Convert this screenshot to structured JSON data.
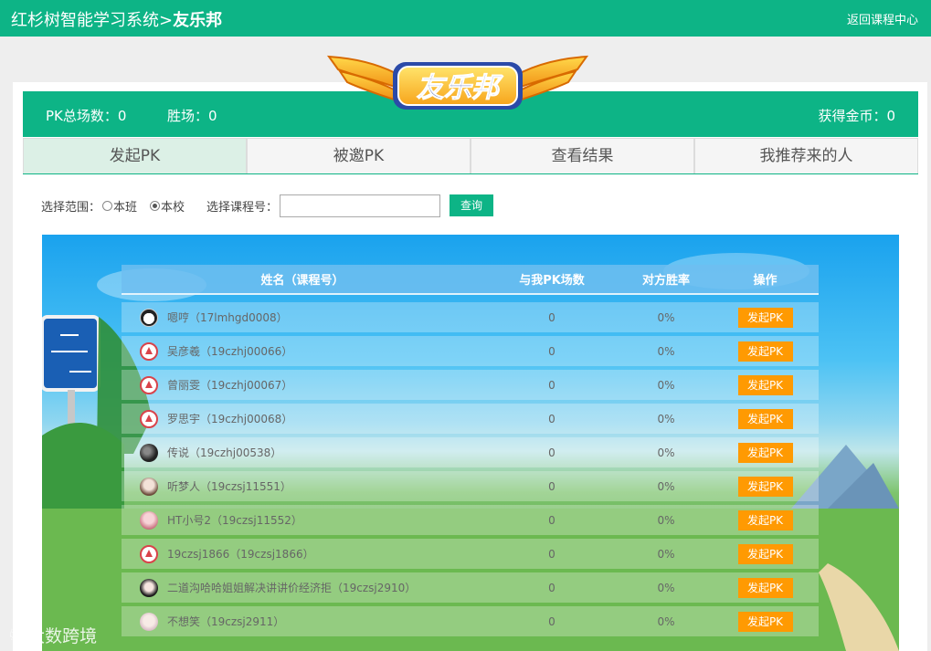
{
  "header": {
    "system_name": "红杉树智能学习系统",
    "separator": ">",
    "module_name": "友乐邦",
    "back_link": "返回课程中心"
  },
  "logo": {
    "text": "友乐邦"
  },
  "stats": {
    "total_pk": "PK总场数：0",
    "wins": "胜场：0",
    "coins": "获得金币：0"
  },
  "tabs": [
    {
      "label": "发起PK",
      "active": true
    },
    {
      "label": "被邀PK",
      "active": false
    },
    {
      "label": "查看结果",
      "active": false
    },
    {
      "label": "我推荐来的人",
      "active": false
    }
  ],
  "filter": {
    "scope_label": "选择范围：",
    "option_class": "本班",
    "option_school": "本校",
    "selected": "本校",
    "course_label": "选择课程号：",
    "course_value": "",
    "query_button": "查询"
  },
  "table": {
    "headers": {
      "name": "姓名（课程号）",
      "count": "与我PK场数",
      "rate": "对方胜率",
      "op": "操作"
    },
    "action_label": "发起PK",
    "rows": [
      {
        "name": "嗯哼（17lmhgd0008）",
        "count": "0",
        "rate": "0%",
        "avatar": "panda"
      },
      {
        "name": "吴彦羲（19czhj00066）",
        "count": "0",
        "rate": "0%",
        "avatar": "logo"
      },
      {
        "name": "曾丽雯（19czhj00067）",
        "count": "0",
        "rate": "0%",
        "avatar": "logo"
      },
      {
        "name": "罗思宇（19czhj00068）",
        "count": "0",
        "rate": "0%",
        "avatar": "logo"
      },
      {
        "name": "传说（19czhj00538）",
        "count": "0",
        "rate": "0%",
        "avatar": "dark"
      },
      {
        "name": "听梦人（19czsj11551）",
        "count": "0",
        "rate": "0%",
        "avatar": "girl"
      },
      {
        "name": "HT小号2（19czsj11552）",
        "count": "0",
        "rate": "0%",
        "avatar": "pink"
      },
      {
        "name": "19czsj1866（19czsj1866）",
        "count": "0",
        "rate": "0%",
        "avatar": "logo"
      },
      {
        "name": "二道沟哈哈姐姐解决讲讲价经济拒（19czsj2910）",
        "count": "0",
        "rate": "0%",
        "avatar": "anime"
      },
      {
        "name": "不想笑（19czsj2911）",
        "count": "0",
        "rate": "0%",
        "avatar": "soft"
      }
    ]
  },
  "watermark": {
    "text": "大数跨境"
  },
  "colors": {
    "brand_green": "#0db486",
    "action_orange": "#ff9a02",
    "sky_blue": "#1aa2ee"
  }
}
